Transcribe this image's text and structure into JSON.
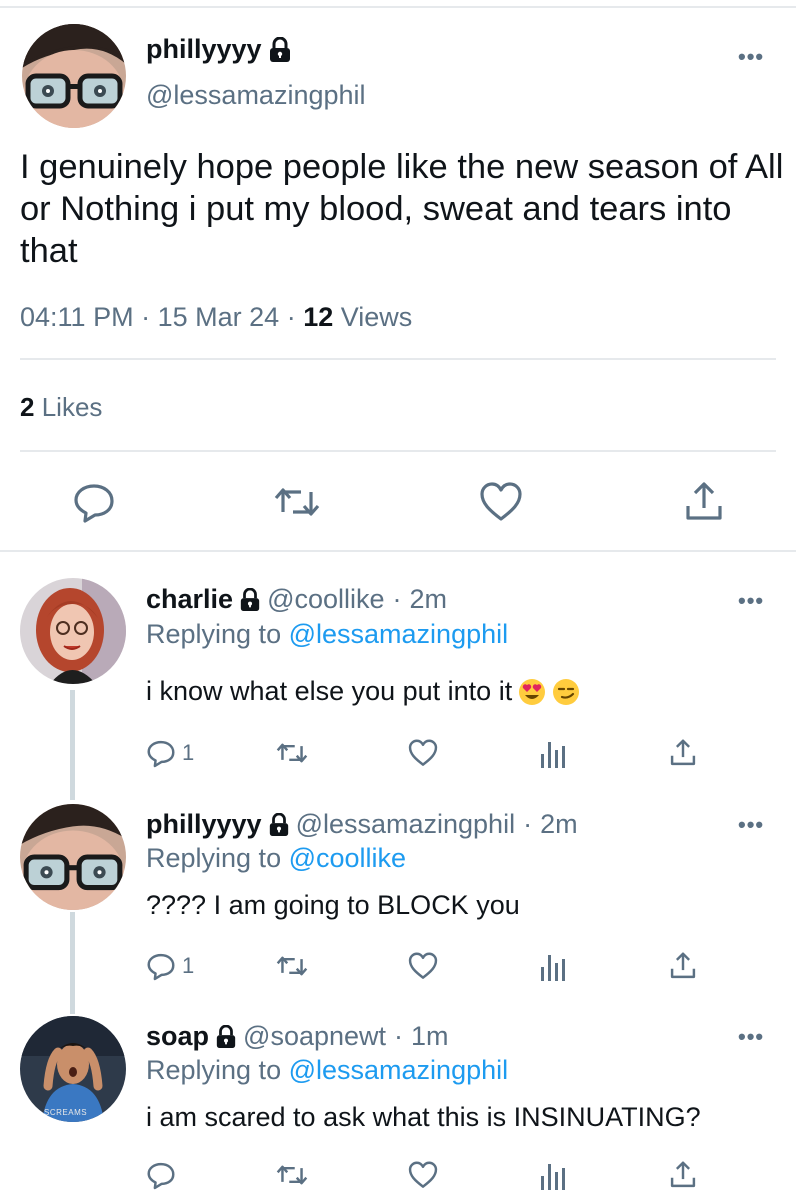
{
  "main_tweet": {
    "name": "phillyyyy",
    "handle": "@lessamazingphil",
    "text": "I genuinely hope people like the new season of All or Nothing i put my blood, sweat and tears into that",
    "time": "04:11 PM",
    "date": "15 Mar 24",
    "views_count": "12",
    "views_label": "Views",
    "likes_count": "2",
    "likes_label": "Likes",
    "more_label": "•••"
  },
  "replies": [
    {
      "name": "charlie",
      "handle": "@coollike",
      "time_sep": "·",
      "time": "2m",
      "replying_prefix": "Replying to",
      "replying_to": "@lessamazingphil",
      "text": "i know what else you put into it",
      "emojis": [
        "heart-eyes",
        "smirk"
      ],
      "reply_count": "1",
      "more_label": "•••"
    },
    {
      "name": "phillyyyy",
      "handle": "@lessamazingphil",
      "time_sep": "·",
      "time": "2m",
      "replying_prefix": "Replying to",
      "replying_to": "@coollike",
      "text": "???? I am going to BLOCK you",
      "reply_count": "1",
      "more_label": "•••"
    },
    {
      "name": "soap",
      "handle": "@soapnewt",
      "time_sep": "·",
      "time": "1m",
      "replying_prefix": "Replying to",
      "replying_to": "@lessamazingphil",
      "text": "i am scared to ask what this is INSINUATING?",
      "avatar_caption": "SCREAMS",
      "more_label": "•••"
    }
  ],
  "colors": {
    "text": "#0f1419",
    "secondary": "#5b7083",
    "link": "#1d9bf0",
    "divider": "#e6e9ec",
    "thread_line": "#cfd9de"
  },
  "icons": [
    "lock-icon",
    "reply-icon",
    "retweet-icon",
    "like-icon",
    "share-icon",
    "analytics-icon",
    "more-icon"
  ]
}
